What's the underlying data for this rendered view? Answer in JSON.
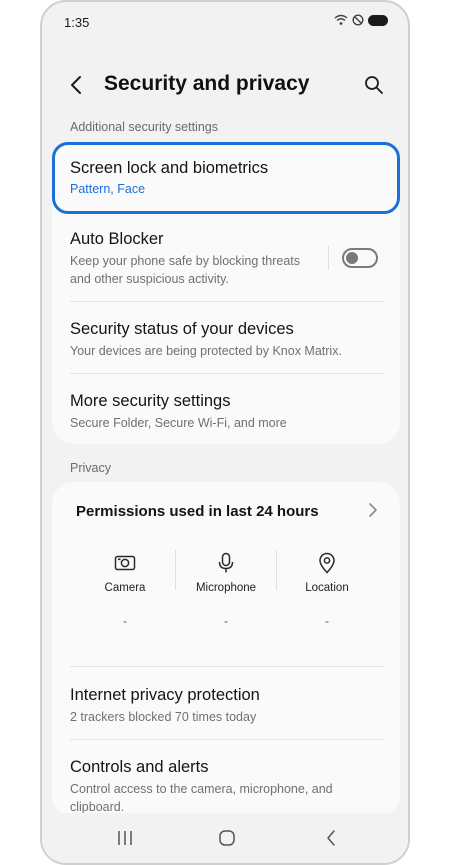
{
  "status": {
    "time": "1:35"
  },
  "header": {
    "title": "Security and privacy"
  },
  "sections": {
    "security_label": "Additional security settings",
    "privacy_label": "Privacy"
  },
  "security_items": [
    {
      "title": "Screen lock and biometrics",
      "subtitle": "Pattern, Face"
    },
    {
      "title": "Auto Blocker",
      "subtitle": "Keep your phone safe by blocking threats and other suspicious activity.",
      "toggle_on": false
    },
    {
      "title": "Security status of your devices",
      "subtitle": "Your devices are being protected by Knox Matrix."
    },
    {
      "title": "More security settings",
      "subtitle": "Secure Folder, Secure Wi-Fi, and more"
    }
  ],
  "permissions": {
    "title": "Permissions used in last 24 hours",
    "items": [
      {
        "label": "Camera",
        "value": "-",
        "icon": "camera-icon"
      },
      {
        "label": "Microphone",
        "value": "-",
        "icon": "microphone-icon"
      },
      {
        "label": "Location",
        "value": "-",
        "icon": "location-icon"
      }
    ]
  },
  "privacy_items": [
    {
      "title": "Internet privacy protection",
      "subtitle": "2 trackers blocked 70 times today"
    },
    {
      "title": "Controls and alerts",
      "subtitle": "Control access to the camera, microphone, and clipboard."
    }
  ],
  "colors": {
    "accent": "#1a6fd9",
    "background": "#f2f2f2",
    "card": "#fafafa"
  }
}
